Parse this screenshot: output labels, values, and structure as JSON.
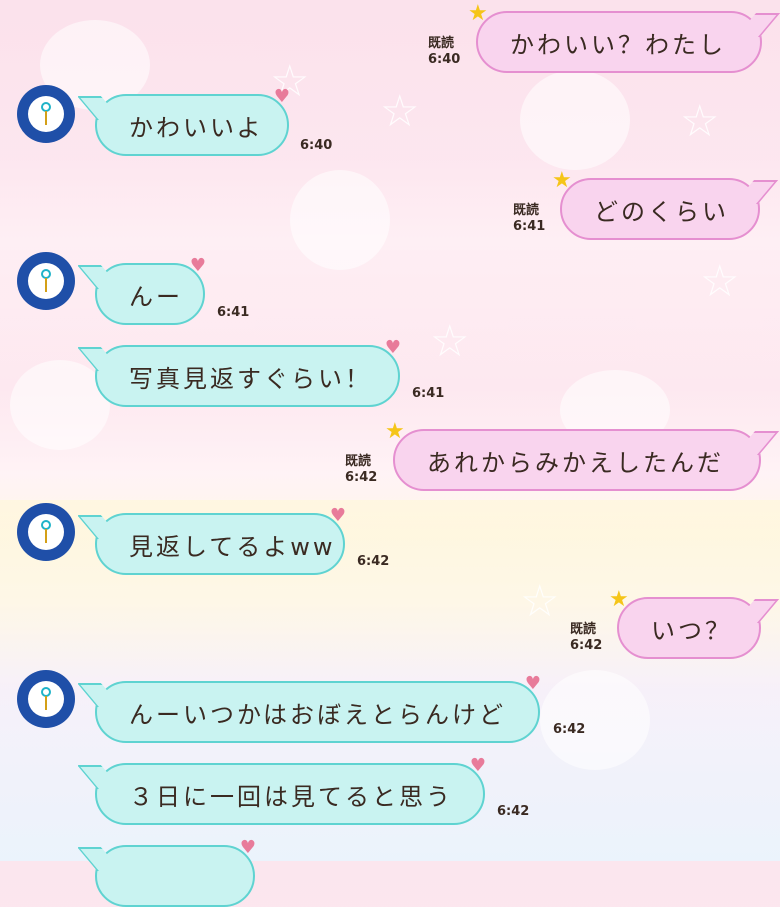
{
  "chat": {
    "messages": [
      {
        "side": "right",
        "text": "かわいい？わたし",
        "read": "既読",
        "time": "6:40"
      },
      {
        "side": "left",
        "text": "かわいいよ",
        "time": "6:40"
      },
      {
        "side": "right",
        "text": "どのくらい",
        "read": "既読",
        "time": "6:41"
      },
      {
        "side": "left",
        "text": "んー",
        "time": "6:41"
      },
      {
        "side": "left",
        "text": "写真見返すぐらい！",
        "time": "6:41"
      },
      {
        "side": "right",
        "text": "あれからみかえしたんだ",
        "read": "既読",
        "time": "6:42"
      },
      {
        "side": "left",
        "text": "見返してるよww",
        "time": "6:42"
      },
      {
        "side": "right",
        "text": "いつ？",
        "read": "既読",
        "time": "6:42"
      },
      {
        "side": "left",
        "text": "んーいつかはおぼえとらんけど",
        "time": "6:42"
      },
      {
        "side": "left",
        "text": "３日に一回は見てると思う",
        "time": "6:42"
      }
    ]
  },
  "colors": {
    "left_bubble": "#c9f3f1",
    "left_border": "#5fd3d1",
    "right_bubble": "#f9d4ee",
    "right_border": "#e58fd0",
    "avatar": "#1f4fa8"
  },
  "icons": {
    "avatar": "lightbulb-icon",
    "heart": "heart-icon",
    "star": "star-icon"
  }
}
